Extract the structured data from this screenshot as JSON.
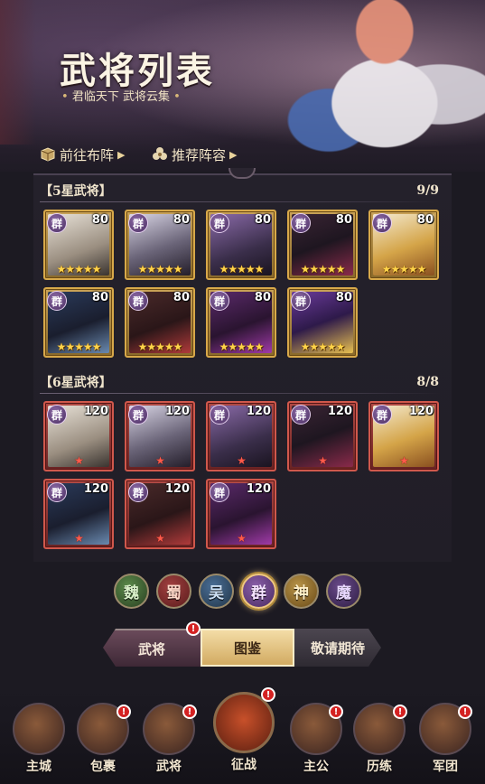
{
  "header": {
    "title": "武将列表",
    "subtitle_left": "君临天下",
    "subtitle_right": "武将云集",
    "go_formation": "前往布阵",
    "recommend": "推荐阵容"
  },
  "sections": [
    {
      "label": "【5星武将】",
      "count": "9/9",
      "star_color": "gold",
      "cards": [
        {
          "faction": "群",
          "level": "80",
          "stars": "★★★★★"
        },
        {
          "faction": "群",
          "level": "80",
          "stars": "★★★★★"
        },
        {
          "faction": "群",
          "level": "80",
          "stars": "★★★★★"
        },
        {
          "faction": "群",
          "level": "80",
          "stars": "★★★★★"
        },
        {
          "faction": "群",
          "level": "80",
          "stars": "★★★★★"
        },
        {
          "faction": "群",
          "level": "80",
          "stars": "★★★★★"
        },
        {
          "faction": "群",
          "level": "80",
          "stars": "★★★★★"
        },
        {
          "faction": "群",
          "level": "80",
          "stars": "★★★★★"
        },
        {
          "faction": "群",
          "level": "80",
          "stars": "★★★★★"
        }
      ]
    },
    {
      "label": "【6星武将】",
      "count": "8/8",
      "star_color": "red",
      "cards": [
        {
          "faction": "群",
          "level": "120",
          "stars": "★"
        },
        {
          "faction": "群",
          "level": "120",
          "stars": "★"
        },
        {
          "faction": "群",
          "level": "120",
          "stars": "★"
        },
        {
          "faction": "群",
          "level": "120",
          "stars": "★"
        },
        {
          "faction": "群",
          "level": "120",
          "stars": "★"
        },
        {
          "faction": "群",
          "level": "120",
          "stars": "★"
        },
        {
          "faction": "群",
          "level": "120",
          "stars": "★"
        },
        {
          "faction": "群",
          "level": "120",
          "stars": "★"
        }
      ]
    }
  ],
  "factions": [
    {
      "label": "魏",
      "key": "wei"
    },
    {
      "label": "蜀",
      "key": "shu"
    },
    {
      "label": "吴",
      "key": "wu"
    },
    {
      "label": "群",
      "key": "qun",
      "selected": true
    },
    {
      "label": "神",
      "key": "shen"
    },
    {
      "label": "魔",
      "key": "mo"
    }
  ],
  "tabs": {
    "general": "武将",
    "codex": "图鉴",
    "coming": "敬请期待",
    "active": "图鉴"
  },
  "badge": "!",
  "nav": [
    {
      "label": "主城",
      "badge": false
    },
    {
      "label": "包裹",
      "badge": true
    },
    {
      "label": "武将",
      "badge": true
    },
    {
      "label": "征战",
      "badge": true
    },
    {
      "label": "主公",
      "badge": true
    },
    {
      "label": "历练",
      "badge": true
    },
    {
      "label": "军团",
      "badge": true
    }
  ],
  "colors": {
    "gold_frame": "#d8a94a",
    "red_frame": "#d0584c",
    "faction_purple": "#6a4a8a",
    "badge_red": "#d42222"
  }
}
